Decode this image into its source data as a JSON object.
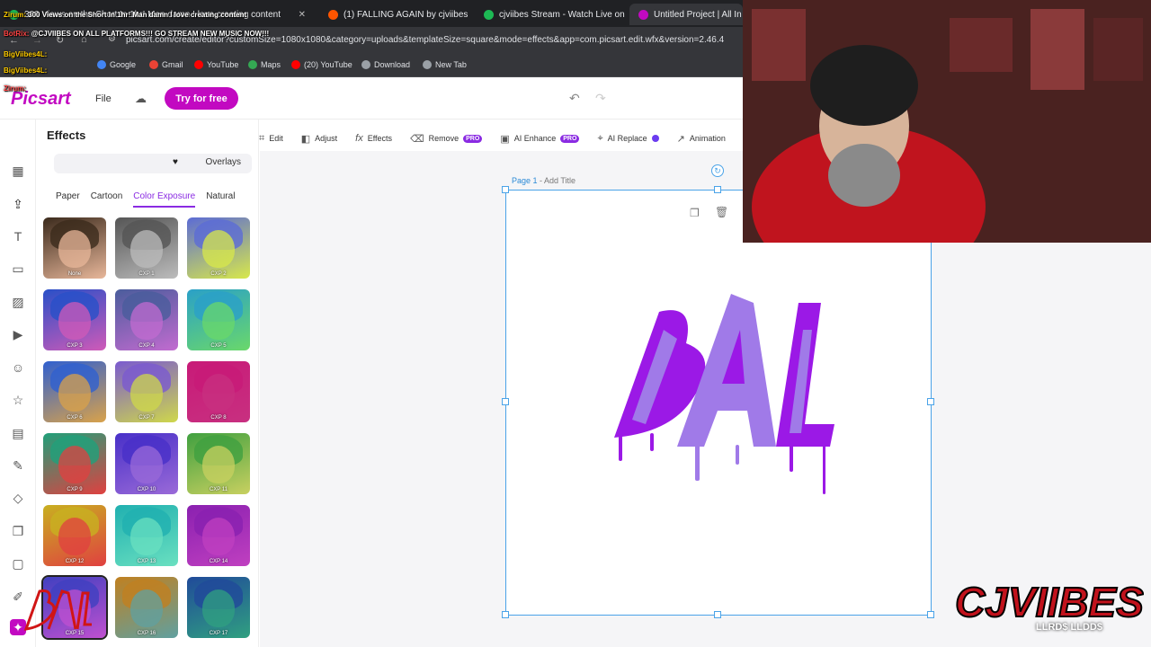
{
  "browser": {
    "tabs": [
      {
        "label": "300 Views on the Short In 1hr! Man damn I love creating content",
        "color": "#1db954"
      },
      {
        "label": "(1) FALLING AGAIN by cjviibes",
        "color": "#ff5500"
      },
      {
        "label": "cjviibes Stream - Watch Live on",
        "color": "#1db954"
      },
      {
        "label": "Untitled Project | All In One",
        "color": "#c209c1"
      }
    ],
    "url": "picsart.com/create/editor?customSize=1080x1080&category=uploads&templateSize=square&mode=effects&app=com.picsart.edit.wfx&version=2.46.4",
    "bookmarks": [
      {
        "label": "Google",
        "color": "#4285f4"
      },
      {
        "label": "Gmail",
        "color": "#ea4335"
      },
      {
        "label": "YouTube",
        "color": "#ff0000"
      },
      {
        "label": "Maps",
        "color": "#34a853"
      },
      {
        "label": "(20) YouTube",
        "color": "#ff0000"
      },
      {
        "label": "Download",
        "color": "#9aa0a6"
      },
      {
        "label": "New Tab",
        "color": "#9aa0a6"
      }
    ]
  },
  "app": {
    "logo": "Picsart",
    "file_menu": "File",
    "try_free": "Try for free",
    "accent": "#c209c1"
  },
  "toolbar": {
    "items": [
      {
        "label": "Edit",
        "icon": "crop-icon"
      },
      {
        "label": "Adjust",
        "icon": "adjust-icon"
      },
      {
        "label": "Effects",
        "icon": "fx-icon"
      },
      {
        "label": "Remove",
        "icon": "eraser-icon",
        "badge": "PRO"
      },
      {
        "label": "AI Enhance",
        "icon": "enhance-icon",
        "badge": "PRO"
      },
      {
        "label": "AI Replace",
        "icon": "replace-icon",
        "dot": true
      },
      {
        "label": "Animation",
        "icon": "animation-icon"
      }
    ]
  },
  "panel": {
    "title": "Effects",
    "segment_right": "Overlays",
    "categories": [
      "Paper",
      "Cartoon",
      "Color Exposure",
      "Natural"
    ],
    "active_category": "Color Exposure",
    "effects": [
      {
        "label": "None",
        "hair": "#3b2a1c",
        "face": "#e8b79a"
      },
      {
        "label": "CXP 1",
        "hair": "#555555",
        "face": "#bcbcbc"
      },
      {
        "label": "CXP 2",
        "hair": "#5b6bd6",
        "face": "#d8e84a"
      },
      {
        "label": "CXP 3",
        "hair": "#2850c8",
        "face": "#d05ab8"
      },
      {
        "label": "CXP 4",
        "hair": "#4a5d9c",
        "face": "#c26bd0"
      },
      {
        "label": "CXP 5",
        "hair": "#2aa0c8",
        "face": "#6ad86a"
      },
      {
        "label": "CXP 6",
        "hair": "#3060d0",
        "face": "#d9a24a"
      },
      {
        "label": "CXP 7",
        "hair": "#7a5ad0",
        "face": "#cfd84a"
      },
      {
        "label": "CXP 8",
        "hair": "#c81a78",
        "face": "#c83080"
      },
      {
        "label": "CXP 9",
        "hair": "#20a07a",
        "face": "#e04040"
      },
      {
        "label": "CXP 10",
        "hair": "#4830c8",
        "face": "#9a6ad8"
      },
      {
        "label": "CXP 11",
        "hair": "#40a040",
        "face": "#c8d060"
      },
      {
        "label": "CXP 12",
        "hair": "#c8b020",
        "face": "#e04040"
      },
      {
        "label": "CXP 13",
        "hair": "#20b0b0",
        "face": "#6ae0c0"
      },
      {
        "label": "CXP 14",
        "hair": "#8a20b0",
        "face": "#c040c0"
      },
      {
        "label": "CXP 15",
        "hair": "#4040c0",
        "face": "#c050d0"
      },
      {
        "label": "CXP 16",
        "hair": "#c08020",
        "face": "#60a0a0"
      },
      {
        "label": "CXP 17",
        "hair": "#204a9a",
        "face": "#30a080"
      }
    ],
    "selected_index": 15
  },
  "canvas": {
    "page_label": "Page 1",
    "add_title": "Add Title",
    "artwork_text": "BAL",
    "artwork_color_dark": "#9b19e6",
    "artwork_color_light": "#a07ae8"
  },
  "stream": {
    "chat": [
      {
        "user": "Zirum:",
        "text": "300 Views on the Short In 1hr! Man damn I love creating content"
      },
      {
        "user": "BotRix:",
        "text": "@CJVIIBES ON ALL PLATFORMS!!! GO STREAM NEW MUSIC NOW!!!"
      },
      {
        "user": "BigViibes4L:",
        "text": ""
      },
      {
        "user": "BigViibes4L:",
        "text": ""
      },
      {
        "user": "Zirum:",
        "text": ""
      }
    ],
    "brand": "CJVIIBES",
    "brand_sub": "LLRD$ LLDD$"
  }
}
